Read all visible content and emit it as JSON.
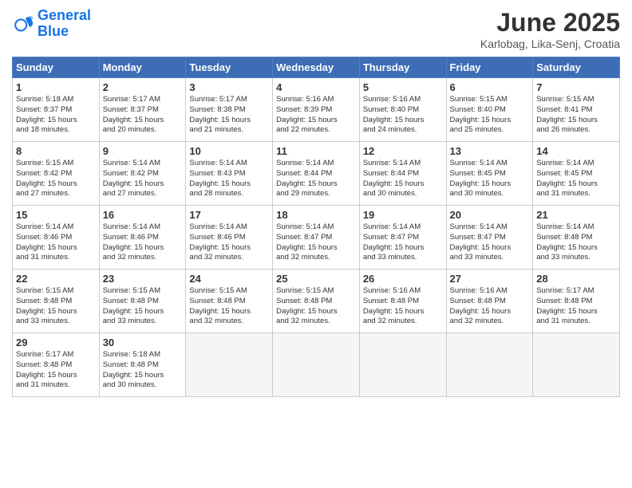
{
  "logo": {
    "line1": "General",
    "line2": "Blue"
  },
  "title": "June 2025",
  "location": "Karlobag, Lika-Senj, Croatia",
  "headers": [
    "Sunday",
    "Monday",
    "Tuesday",
    "Wednesday",
    "Thursday",
    "Friday",
    "Saturday"
  ],
  "weeks": [
    [
      {
        "day": "1",
        "info": "Sunrise: 5:18 AM\nSunset: 8:37 PM\nDaylight: 15 hours\nand 18 minutes."
      },
      {
        "day": "2",
        "info": "Sunrise: 5:17 AM\nSunset: 8:37 PM\nDaylight: 15 hours\nand 20 minutes."
      },
      {
        "day": "3",
        "info": "Sunrise: 5:17 AM\nSunset: 8:38 PM\nDaylight: 15 hours\nand 21 minutes."
      },
      {
        "day": "4",
        "info": "Sunrise: 5:16 AM\nSunset: 8:39 PM\nDaylight: 15 hours\nand 22 minutes."
      },
      {
        "day": "5",
        "info": "Sunrise: 5:16 AM\nSunset: 8:40 PM\nDaylight: 15 hours\nand 24 minutes."
      },
      {
        "day": "6",
        "info": "Sunrise: 5:15 AM\nSunset: 8:40 PM\nDaylight: 15 hours\nand 25 minutes."
      },
      {
        "day": "7",
        "info": "Sunrise: 5:15 AM\nSunset: 8:41 PM\nDaylight: 15 hours\nand 26 minutes."
      }
    ],
    [
      {
        "day": "8",
        "info": "Sunrise: 5:15 AM\nSunset: 8:42 PM\nDaylight: 15 hours\nand 27 minutes."
      },
      {
        "day": "9",
        "info": "Sunrise: 5:14 AM\nSunset: 8:42 PM\nDaylight: 15 hours\nand 27 minutes."
      },
      {
        "day": "10",
        "info": "Sunrise: 5:14 AM\nSunset: 8:43 PM\nDaylight: 15 hours\nand 28 minutes."
      },
      {
        "day": "11",
        "info": "Sunrise: 5:14 AM\nSunset: 8:44 PM\nDaylight: 15 hours\nand 29 minutes."
      },
      {
        "day": "12",
        "info": "Sunrise: 5:14 AM\nSunset: 8:44 PM\nDaylight: 15 hours\nand 30 minutes."
      },
      {
        "day": "13",
        "info": "Sunrise: 5:14 AM\nSunset: 8:45 PM\nDaylight: 15 hours\nand 30 minutes."
      },
      {
        "day": "14",
        "info": "Sunrise: 5:14 AM\nSunset: 8:45 PM\nDaylight: 15 hours\nand 31 minutes."
      }
    ],
    [
      {
        "day": "15",
        "info": "Sunrise: 5:14 AM\nSunset: 8:46 PM\nDaylight: 15 hours\nand 31 minutes."
      },
      {
        "day": "16",
        "info": "Sunrise: 5:14 AM\nSunset: 8:46 PM\nDaylight: 15 hours\nand 32 minutes."
      },
      {
        "day": "17",
        "info": "Sunrise: 5:14 AM\nSunset: 8:46 PM\nDaylight: 15 hours\nand 32 minutes."
      },
      {
        "day": "18",
        "info": "Sunrise: 5:14 AM\nSunset: 8:47 PM\nDaylight: 15 hours\nand 32 minutes."
      },
      {
        "day": "19",
        "info": "Sunrise: 5:14 AM\nSunset: 8:47 PM\nDaylight: 15 hours\nand 33 minutes."
      },
      {
        "day": "20",
        "info": "Sunrise: 5:14 AM\nSunset: 8:47 PM\nDaylight: 15 hours\nand 33 minutes."
      },
      {
        "day": "21",
        "info": "Sunrise: 5:14 AM\nSunset: 8:48 PM\nDaylight: 15 hours\nand 33 minutes."
      }
    ],
    [
      {
        "day": "22",
        "info": "Sunrise: 5:15 AM\nSunset: 8:48 PM\nDaylight: 15 hours\nand 33 minutes."
      },
      {
        "day": "23",
        "info": "Sunrise: 5:15 AM\nSunset: 8:48 PM\nDaylight: 15 hours\nand 33 minutes."
      },
      {
        "day": "24",
        "info": "Sunrise: 5:15 AM\nSunset: 8:48 PM\nDaylight: 15 hours\nand 32 minutes."
      },
      {
        "day": "25",
        "info": "Sunrise: 5:15 AM\nSunset: 8:48 PM\nDaylight: 15 hours\nand 32 minutes."
      },
      {
        "day": "26",
        "info": "Sunrise: 5:16 AM\nSunset: 8:48 PM\nDaylight: 15 hours\nand 32 minutes."
      },
      {
        "day": "27",
        "info": "Sunrise: 5:16 AM\nSunset: 8:48 PM\nDaylight: 15 hours\nand 32 minutes."
      },
      {
        "day": "28",
        "info": "Sunrise: 5:17 AM\nSunset: 8:48 PM\nDaylight: 15 hours\nand 31 minutes."
      }
    ],
    [
      {
        "day": "29",
        "info": "Sunrise: 5:17 AM\nSunset: 8:48 PM\nDaylight: 15 hours\nand 31 minutes."
      },
      {
        "day": "30",
        "info": "Sunrise: 5:18 AM\nSunset: 8:48 PM\nDaylight: 15 hours\nand 30 minutes."
      },
      null,
      null,
      null,
      null,
      null
    ]
  ]
}
